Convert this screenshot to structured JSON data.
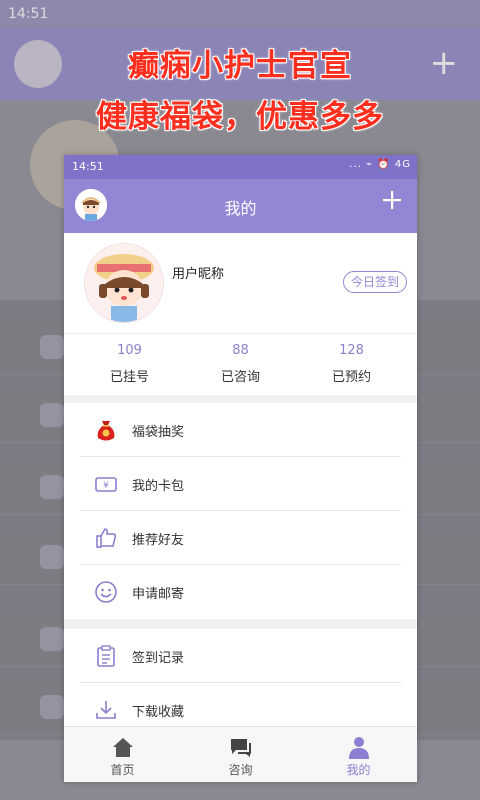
{
  "promo": {
    "line1": "癫痫小护士官宣",
    "line2": "健康福袋，优惠多多"
  },
  "status_bar": {
    "time": "14:51",
    "icons": "... ⌁ ⏰ 4G"
  },
  "app_bar": {
    "title": "我的",
    "add_icon": "plus-icon"
  },
  "profile": {
    "nickname": "用户昵称",
    "sign_in_label": "今日签到"
  },
  "stats": [
    {
      "value": "109",
      "label": "已挂号"
    },
    {
      "value": "88",
      "label": "已咨询"
    },
    {
      "value": "128",
      "label": "已预约"
    }
  ],
  "menu": [
    {
      "label": "福袋抽奖",
      "icon": "lucky-bag-icon"
    },
    {
      "label": "我的卡包",
      "icon": "card-wallet-icon"
    },
    {
      "label": "推荐好友",
      "icon": "thumbs-up-icon"
    },
    {
      "label": "申请邮寄",
      "icon": "smile-icon"
    },
    {
      "label": "签到记录",
      "icon": "clipboard-icon"
    },
    {
      "label": "下载收藏",
      "icon": "download-icon"
    }
  ],
  "tabs": [
    {
      "label": "首页",
      "icon": "home-icon",
      "active": false
    },
    {
      "label": "咨询",
      "icon": "chat-icon",
      "active": false
    },
    {
      "label": "我的",
      "icon": "person-icon",
      "active": true
    }
  ],
  "colors": {
    "accent": "#9187d4",
    "promo_text": "#ff2f1f"
  }
}
